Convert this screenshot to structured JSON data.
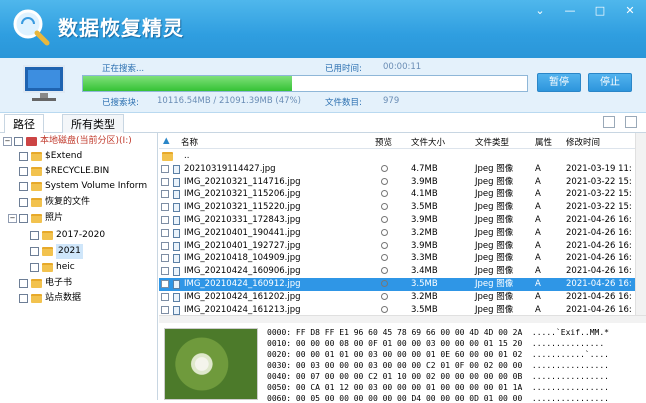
{
  "window": {
    "title": "数据恢复精灵",
    "controls": [
      "⌄",
      "—",
      "□",
      "✕"
    ]
  },
  "progress": {
    "status_label": "正在搜索...",
    "elapsed_label": "已用时间:",
    "elapsed_value": "00:00:11",
    "fraction": 0.47,
    "searched_label": "已搜索块:",
    "searched_value": "10116.54MB / 21091.39MB (47%)",
    "files_label": "文件数目:",
    "files_value": "979",
    "pause_label": "暂停",
    "stop_label": "停止"
  },
  "tabs": [
    {
      "label": "路径"
    },
    {
      "label": "所有类型"
    }
  ],
  "tree": [
    {
      "label": "本地磁盘(当前分区)(I:)",
      "kind": "drive"
    },
    {
      "label": "$Extend",
      "kind": "folder"
    },
    {
      "label": "$RECYCLE.BIN",
      "kind": "folder"
    },
    {
      "label": "System Volume Inform",
      "kind": "folder"
    },
    {
      "label": "恢复的文件",
      "kind": "folder"
    },
    {
      "label": "照片",
      "kind": "folder"
    },
    {
      "label": "2017-2020",
      "kind": "folder"
    },
    {
      "label": "2021",
      "kind": "folder",
      "selected": true
    },
    {
      "label": "heic",
      "kind": "folder"
    },
    {
      "label": "电子书",
      "kind": "folder"
    },
    {
      "label": "站点数据",
      "kind": "folder"
    }
  ],
  "columns": {
    "name": "名称",
    "preview": "预览",
    "size": "文件大小",
    "type": "文件类型",
    "attr": "属性",
    "modified": "修改时间"
  },
  "files": [
    {
      "name": "..",
      "size": "",
      "type": "",
      "attr": "",
      "modified": ""
    },
    {
      "name": "20210319114427.jpg",
      "size": "4.7MB",
      "type": "Jpeg 图像",
      "attr": "A",
      "modified": "2021-03-19 11:"
    },
    {
      "name": "IMG_20210321_114716.jpg",
      "size": "3.9MB",
      "type": "Jpeg 图像",
      "attr": "A",
      "modified": "2021-03-22 15:"
    },
    {
      "name": "IMG_20210321_115206.jpg",
      "size": "4.1MB",
      "type": "Jpeg 图像",
      "attr": "A",
      "modified": "2021-03-22 15:"
    },
    {
      "name": "IMG_20210321_115220.jpg",
      "size": "3.5MB",
      "type": "Jpeg 图像",
      "attr": "A",
      "modified": "2021-03-22 15:"
    },
    {
      "name": "IMG_20210331_172843.jpg",
      "size": "3.9MB",
      "type": "Jpeg 图像",
      "attr": "A",
      "modified": "2021-04-26 16:"
    },
    {
      "name": "IMG_20210401_190441.jpg",
      "size": "3.2MB",
      "type": "Jpeg 图像",
      "attr": "A",
      "modified": "2021-04-26 16:"
    },
    {
      "name": "IMG_20210401_192727.jpg",
      "size": "3.9MB",
      "type": "Jpeg 图像",
      "attr": "A",
      "modified": "2021-04-26 16:"
    },
    {
      "name": "IMG_20210418_104909.jpg",
      "size": "3.3MB",
      "type": "Jpeg 图像",
      "attr": "A",
      "modified": "2021-04-26 16:"
    },
    {
      "name": "IMG_20210424_160906.jpg",
      "size": "3.4MB",
      "type": "Jpeg 图像",
      "attr": "A",
      "modified": "2021-04-26 16:"
    },
    {
      "name": "IMG_20210424_160912.jpg",
      "size": "3.5MB",
      "type": "Jpeg 图像",
      "attr": "A",
      "modified": "2021-04-26 16:",
      "selected": true
    },
    {
      "name": "IMG_20210424_161202.jpg",
      "size": "3.2MB",
      "type": "Jpeg 图像",
      "attr": "A",
      "modified": "2021-04-26 16:"
    },
    {
      "name": "IMG_20210424_161213.jpg",
      "size": "3.5MB",
      "type": "Jpeg 图像",
      "attr": "A",
      "modified": "2021-04-26 16:"
    }
  ],
  "hex": [
    "0000: FF D8 FF E1 96 60 45 78 69 66 00 00 4D 4D 00 2A  .....`Exif..MM.*",
    "0010: 00 00 00 08 00 0F 01 00 00 03 00 00 00 01 15 20  ............... ",
    "0020: 00 00 01 01 00 03 00 00 00 01 0E 60 00 00 01 02  ...........`....",
    "0030: 00 03 00 00 00 03 00 00 00 C2 01 0F 00 02 00 00  ................",
    "0040: 00 07 00 00 00 C2 01 10 00 02 00 00 00 00 00 0B  ................",
    "0050: 00 CA 01 12 00 03 00 00 00 01 00 00 00 00 01 1A  ................",
    "0060: 00 05 00 00 00 00 00 00 D4 00 00 00 0D 01 00 00  ................"
  ]
}
